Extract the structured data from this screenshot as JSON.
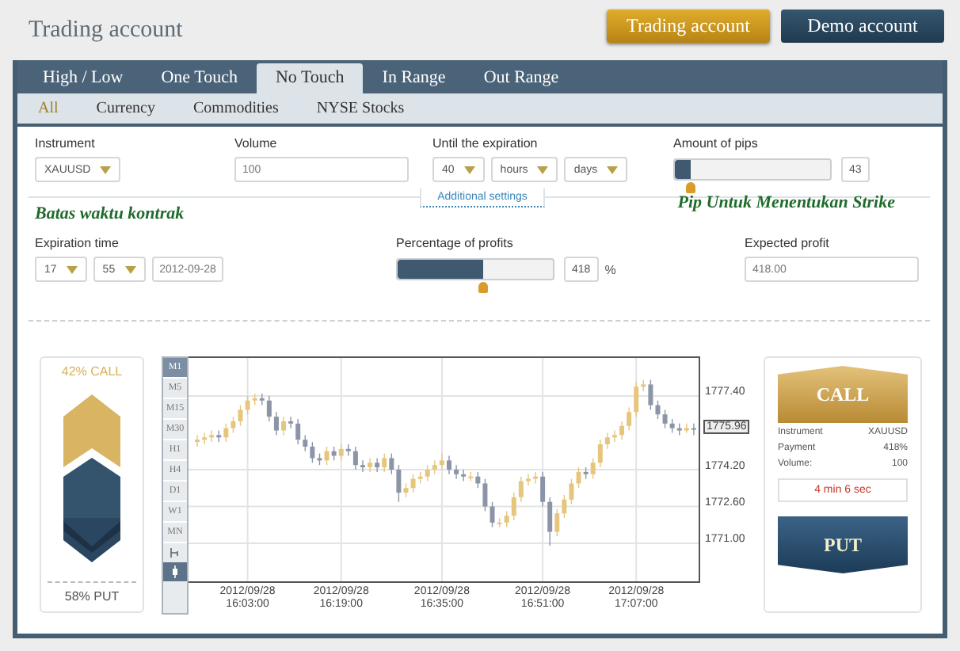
{
  "header": {
    "title": "Trading account",
    "buttons": [
      {
        "label": "Trading account",
        "kind": "gold",
        "selected": true
      },
      {
        "label": "Demo account",
        "kind": "dark",
        "selected": false
      }
    ]
  },
  "tabs": [
    {
      "label": "High / Low",
      "selected": false
    },
    {
      "label": "One Touch",
      "selected": false
    },
    {
      "label": "No Touch",
      "selected": true
    },
    {
      "label": "In Range",
      "selected": false
    },
    {
      "label": "Out Range",
      "selected": false
    }
  ],
  "subtabs": [
    {
      "label": "All",
      "selected": true
    },
    {
      "label": "Currency",
      "selected": false
    },
    {
      "label": "Commodities",
      "selected": false
    },
    {
      "label": "NYSE Stocks",
      "selected": false
    }
  ],
  "fields_top": [
    {
      "label": "Instrument",
      "controls": [
        {
          "kind": "select",
          "value": "XAUUSD"
        }
      ]
    },
    {
      "label": "Volume",
      "controls": [
        {
          "kind": "input",
          "value": "100"
        }
      ]
    },
    {
      "label": "Until the expiration",
      "controls": [
        {
          "kind": "select",
          "value": "40"
        },
        {
          "kind": "select",
          "value": "hours"
        },
        {
          "kind": "select",
          "value": "days"
        }
      ]
    },
    {
      "label": "Amount of pips",
      "controls": [
        {
          "kind": "slider",
          "level": 0.1
        },
        {
          "kind": "readout",
          "value": "43"
        }
      ]
    }
  ],
  "annotations": [
    "Batas waktu kontrak",
    "Pip Untuk Menentukan Strike"
  ],
  "additional_settings": "Additional settings",
  "fields_bottom": [
    {
      "label": "Expiration time",
      "controls": [
        {
          "kind": "select",
          "value": "17"
        },
        {
          "kind": "select",
          "value": "55"
        },
        {
          "kind": "input",
          "value": "2012-09-28"
        }
      ]
    },
    {
      "label": "Percentage of profits",
      "controls": [
        {
          "kind": "slider",
          "level": 0.55
        },
        {
          "kind": "readout",
          "value": "418"
        },
        {
          "kind": "unit",
          "value": "%"
        }
      ]
    },
    {
      "label": "Expected profit",
      "controls": [
        {
          "kind": "input",
          "value": "418.00"
        }
      ]
    }
  ],
  "gauge": {
    "call": "42% CALL",
    "put": "58% PUT"
  },
  "chart": {
    "timeframes": [
      {
        "label": "M1",
        "selected": true
      },
      {
        "label": "M5",
        "selected": false
      },
      {
        "label": "M15",
        "selected": false
      },
      {
        "label": "M30",
        "selected": false
      },
      {
        "label": "H1",
        "selected": false
      },
      {
        "label": "H4",
        "selected": false
      },
      {
        "label": "D1",
        "selected": false
      },
      {
        "label": "W1",
        "selected": false
      },
      {
        "label": "MN",
        "selected": false
      }
    ],
    "chart_types": [
      {
        "kind": "line",
        "selected": false
      },
      {
        "kind": "candles",
        "selected": true
      }
    ],
    "chart_data": {
      "type": "candlestick",
      "categories": [
        null,
        null,
        null,
        null,
        null,
        null,
        null,
        "2012/09/28 16:03:00",
        null,
        null,
        null,
        null,
        null,
        null,
        null,
        null,
        null,
        null,
        null,
        null,
        "2012/09/28 16:19:00",
        null,
        null,
        null,
        null,
        null,
        null,
        null,
        null,
        null,
        null,
        null,
        null,
        null,
        "2012/09/28 16:35:00",
        null,
        null,
        null,
        null,
        null,
        null,
        null,
        null,
        null,
        null,
        null,
        null,
        null,
        "2012/09/28 16:51:00",
        null,
        null,
        null,
        null,
        null,
        null,
        null,
        null,
        null,
        null,
        null,
        null,
        "2012/09/28 17:07:00",
        null,
        null,
        null,
        null,
        null,
        null,
        null,
        null
      ],
      "ylim": [
        1769.35,
        1779.05
      ],
      "grid": true,
      "ohlc": [
        [
          1775.4,
          1775.7,
          1775.2,
          1775.5
        ],
        [
          1775.5,
          1775.8,
          1775.3,
          1775.6
        ],
        [
          1775.6,
          1775.9,
          1775.4,
          1775.7
        ],
        [
          1775.7,
          1775.9,
          1775.4,
          1775.6
        ],
        [
          1775.6,
          1776.2,
          1775.4,
          1776.0
        ],
        [
          1776.0,
          1776.5,
          1775.8,
          1776.3
        ],
        [
          1776.3,
          1777.0,
          1776.1,
          1776.8
        ],
        [
          1776.8,
          1777.4,
          1776.6,
          1777.2
        ],
        [
          1777.2,
          1777.5,
          1777.0,
          1777.3
        ],
        [
          1777.3,
          1777.5,
          1777.0,
          1777.2
        ],
        [
          1777.2,
          1777.4,
          1776.3,
          1776.5
        ],
        [
          1776.5,
          1776.7,
          1775.7,
          1775.9
        ],
        [
          1775.9,
          1776.5,
          1775.7,
          1776.3
        ],
        [
          1776.3,
          1776.5,
          1776.0,
          1776.2
        ],
        [
          1776.2,
          1776.4,
          1775.3,
          1775.5
        ],
        [
          1775.5,
          1775.7,
          1775.0,
          1775.2
        ],
        [
          1775.2,
          1775.4,
          1774.5,
          1774.7
        ],
        [
          1774.7,
          1774.9,
          1774.4,
          1774.6
        ],
        [
          1774.6,
          1775.2,
          1774.4,
          1775.0
        ],
        [
          1775.0,
          1775.2,
          1774.6,
          1774.8
        ],
        [
          1774.8,
          1775.3,
          1774.6,
          1775.1
        ],
        [
          1775.1,
          1775.3,
          1774.8,
          1775.0
        ],
        [
          1775.0,
          1775.2,
          1774.2,
          1774.4
        ],
        [
          1774.4,
          1774.6,
          1774.1,
          1774.3
        ],
        [
          1774.3,
          1774.7,
          1774.1,
          1774.5
        ],
        [
          1774.5,
          1774.7,
          1774.1,
          1774.3
        ],
        [
          1774.3,
          1774.9,
          1774.1,
          1774.7
        ],
        [
          1774.7,
          1774.9,
          1774.0,
          1774.2
        ],
        [
          1774.2,
          1774.4,
          1772.8,
          1773.2
        ],
        [
          1773.2,
          1773.6,
          1773.0,
          1773.4
        ],
        [
          1773.4,
          1774.0,
          1773.2,
          1773.8
        ],
        [
          1773.8,
          1774.1,
          1773.6,
          1773.9
        ],
        [
          1773.9,
          1774.4,
          1773.7,
          1774.2
        ],
        [
          1774.2,
          1774.6,
          1774.0,
          1774.4
        ],
        [
          1774.4,
          1774.9,
          1774.2,
          1774.6
        ],
        [
          1774.6,
          1774.8,
          1774.0,
          1774.2
        ],
        [
          1774.2,
          1774.4,
          1773.8,
          1774.0
        ],
        [
          1774.0,
          1774.2,
          1773.7,
          1773.9
        ],
        [
          1773.9,
          1774.1,
          1773.7,
          1773.9
        ],
        [
          1773.9,
          1774.1,
          1773.4,
          1773.6
        ],
        [
          1773.6,
          1773.8,
          1772.4,
          1772.6
        ],
        [
          1772.6,
          1772.8,
          1771.7,
          1771.9
        ],
        [
          1771.9,
          1772.1,
          1771.7,
          1771.9
        ],
        [
          1771.9,
          1772.4,
          1771.7,
          1772.2
        ],
        [
          1772.2,
          1773.2,
          1772.0,
          1773.0
        ],
        [
          1773.0,
          1773.9,
          1772.8,
          1773.7
        ],
        [
          1773.7,
          1774.0,
          1773.5,
          1773.8
        ],
        [
          1773.8,
          1774.1,
          1773.6,
          1773.9
        ],
        [
          1773.9,
          1774.1,
          1772.6,
          1772.8
        ],
        [
          1772.8,
          1773.0,
          1770.9,
          1771.5
        ],
        [
          1771.5,
          1772.5,
          1771.3,
          1772.3
        ],
        [
          1772.3,
          1773.1,
          1772.1,
          1772.9
        ],
        [
          1772.9,
          1773.8,
          1772.7,
          1773.6
        ],
        [
          1773.6,
          1774.3,
          1773.4,
          1774.1
        ],
        [
          1774.1,
          1774.3,
          1773.8,
          1774.0
        ],
        [
          1774.0,
          1774.7,
          1773.8,
          1774.5
        ],
        [
          1774.5,
          1775.5,
          1774.3,
          1775.3
        ],
        [
          1775.3,
          1775.8,
          1775.1,
          1775.6
        ],
        [
          1775.6,
          1775.9,
          1775.4,
          1775.7
        ],
        [
          1775.7,
          1776.3,
          1775.5,
          1776.1
        ],
        [
          1776.1,
          1776.9,
          1775.9,
          1776.7
        ],
        [
          1776.7,
          1778.0,
          1776.5,
          1777.8
        ],
        [
          1777.8,
          1778.1,
          1777.6,
          1777.9
        ],
        [
          1777.9,
          1778.1,
          1776.8,
          1777.0
        ],
        [
          1777.0,
          1777.2,
          1776.4,
          1776.6
        ],
        [
          1776.6,
          1776.8,
          1776.0,
          1776.2
        ],
        [
          1776.2,
          1776.4,
          1775.8,
          1776.0
        ],
        [
          1776.0,
          1776.2,
          1775.7,
          1775.9
        ],
        [
          1775.9,
          1776.2,
          1775.8,
          1776.0
        ],
        [
          1776.0,
          1776.2,
          1775.7,
          1775.96
        ]
      ],
      "yticks": [
        {
          "value": 1777.4,
          "label": "1777.40"
        },
        {
          "value": 1774.2,
          "label": "1774.20"
        },
        {
          "value": 1772.6,
          "label": "1772.60"
        },
        {
          "value": 1771.0,
          "label": "1771.00"
        }
      ]
    },
    "current_price": "1775.96"
  },
  "trade": {
    "call": "CALL",
    "put": "PUT",
    "details": [
      {
        "label": "Instrument",
        "value": "XAUUSD"
      },
      {
        "label": "Payment",
        "value": "418%"
      },
      {
        "label": "Volume:",
        "value": "100"
      }
    ],
    "timer": "4 min 6 sec"
  }
}
